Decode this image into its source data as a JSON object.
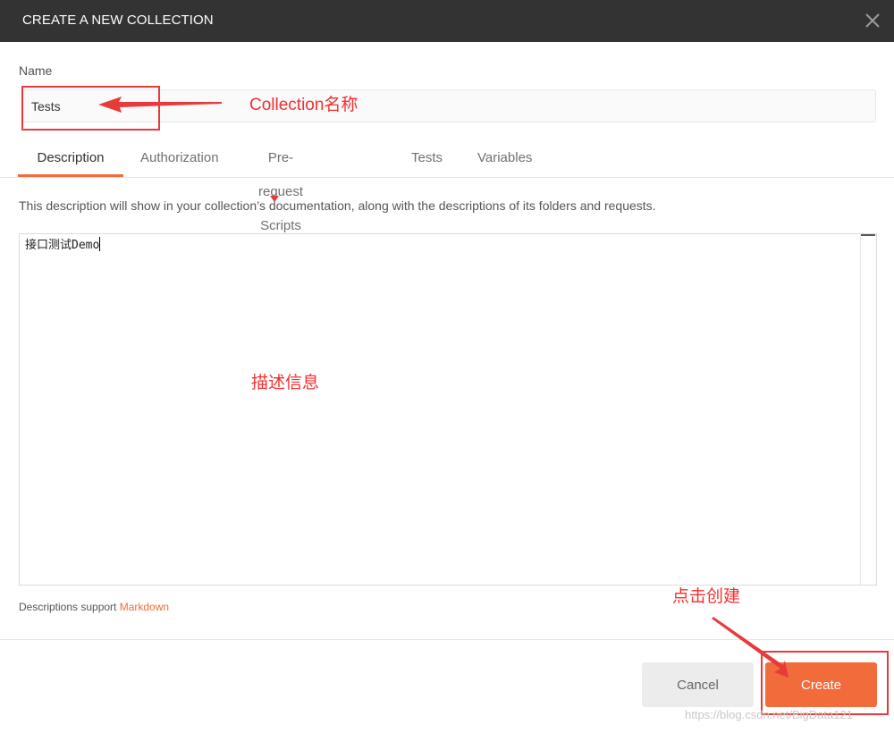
{
  "dialog": {
    "title": "CREATE A NEW COLLECTION"
  },
  "name_field": {
    "label": "Name",
    "value": "Tests"
  },
  "tabs": [
    {
      "label": "Description"
    },
    {
      "label": "Authorization"
    },
    {
      "label": "Pre-request Scripts"
    },
    {
      "label": "Tests"
    },
    {
      "label": "Variables"
    }
  ],
  "active_tab": "Description",
  "description": {
    "help_text": "This description will show in your collection’s documentation, along with the descriptions of its folders and requests.",
    "value": "接口测试Demo",
    "support_prefix": "Descriptions support ",
    "support_link": "Markdown"
  },
  "buttons": {
    "cancel": "Cancel",
    "create": "Create"
  },
  "annotations": {
    "name": "Collection名称",
    "description": "描述信息",
    "create": "点击创建"
  },
  "watermark": "https://blog.csdn.net/BigData121",
  "colors": {
    "accent": "#f26b3a",
    "header": "#333333",
    "annotation": "#f22f2f"
  }
}
